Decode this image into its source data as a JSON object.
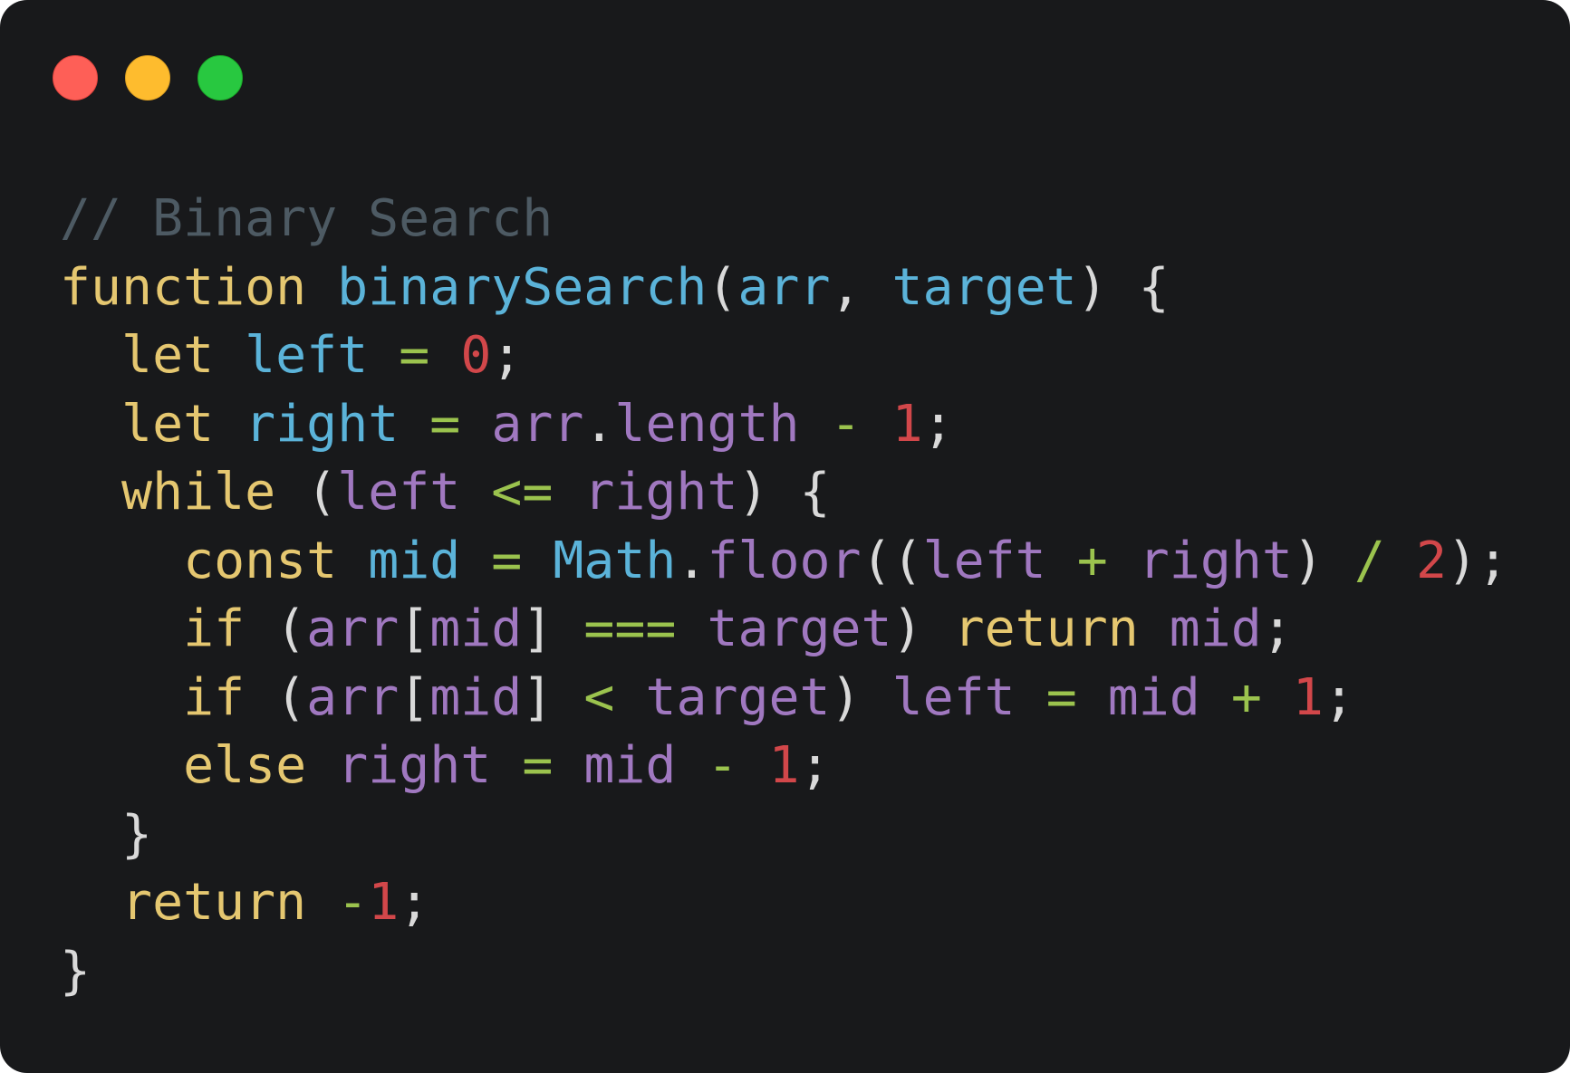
{
  "window": {
    "controls": [
      {
        "name": "close-button",
        "color": "#fe5f57"
      },
      {
        "name": "minimize-button",
        "color": "#febc2e"
      },
      {
        "name": "maximize-button",
        "color": "#28c840"
      }
    ]
  },
  "colors": {
    "background": "#18191b",
    "comment": "#4d5a63",
    "keyword": "#e5c770",
    "identifier": "#5bb3d9",
    "variable": "#a078c0",
    "operator": "#9bc34e",
    "number": "#d2474a",
    "punctuation": "#d9d9d9"
  },
  "code": {
    "language": "javascript",
    "lines": [
      [
        {
          "t": "// Binary Search",
          "k": "comment"
        }
      ],
      [
        {
          "t": "function",
          "k": "keyword"
        },
        {
          "t": " ",
          "k": "punctuation"
        },
        {
          "t": "binarySearch",
          "k": "identifier"
        },
        {
          "t": "(",
          "k": "punctuation"
        },
        {
          "t": "arr",
          "k": "identifier"
        },
        {
          "t": ", ",
          "k": "punctuation"
        },
        {
          "t": "target",
          "k": "identifier"
        },
        {
          "t": ") {",
          "k": "punctuation"
        }
      ],
      [
        {
          "t": "  ",
          "k": "punctuation"
        },
        {
          "t": "let",
          "k": "keyword"
        },
        {
          "t": " ",
          "k": "punctuation"
        },
        {
          "t": "left",
          "k": "identifier"
        },
        {
          "t": " ",
          "k": "punctuation"
        },
        {
          "t": "=",
          "k": "operator"
        },
        {
          "t": " ",
          "k": "punctuation"
        },
        {
          "t": "0",
          "k": "number"
        },
        {
          "t": ";",
          "k": "punctuation"
        }
      ],
      [
        {
          "t": "  ",
          "k": "punctuation"
        },
        {
          "t": "let",
          "k": "keyword"
        },
        {
          "t": " ",
          "k": "punctuation"
        },
        {
          "t": "right",
          "k": "identifier"
        },
        {
          "t": " ",
          "k": "punctuation"
        },
        {
          "t": "=",
          "k": "operator"
        },
        {
          "t": " ",
          "k": "punctuation"
        },
        {
          "t": "arr",
          "k": "variable"
        },
        {
          "t": ".",
          "k": "punctuation"
        },
        {
          "t": "length",
          "k": "variable"
        },
        {
          "t": " ",
          "k": "punctuation"
        },
        {
          "t": "-",
          "k": "operator"
        },
        {
          "t": " ",
          "k": "punctuation"
        },
        {
          "t": "1",
          "k": "number"
        },
        {
          "t": ";",
          "k": "punctuation"
        }
      ],
      [
        {
          "t": "  ",
          "k": "punctuation"
        },
        {
          "t": "while",
          "k": "keyword"
        },
        {
          "t": " (",
          "k": "punctuation"
        },
        {
          "t": "left",
          "k": "variable"
        },
        {
          "t": " ",
          "k": "punctuation"
        },
        {
          "t": "<=",
          "k": "operator"
        },
        {
          "t": " ",
          "k": "punctuation"
        },
        {
          "t": "right",
          "k": "variable"
        },
        {
          "t": ") {",
          "k": "punctuation"
        }
      ],
      [
        {
          "t": "    ",
          "k": "punctuation"
        },
        {
          "t": "const",
          "k": "keyword"
        },
        {
          "t": " ",
          "k": "punctuation"
        },
        {
          "t": "mid",
          "k": "identifier"
        },
        {
          "t": " ",
          "k": "punctuation"
        },
        {
          "t": "=",
          "k": "operator"
        },
        {
          "t": " ",
          "k": "punctuation"
        },
        {
          "t": "Math",
          "k": "identifier"
        },
        {
          "t": ".",
          "k": "punctuation"
        },
        {
          "t": "floor",
          "k": "variable"
        },
        {
          "t": "((",
          "k": "punctuation"
        },
        {
          "t": "left",
          "k": "variable"
        },
        {
          "t": " ",
          "k": "punctuation"
        },
        {
          "t": "+",
          "k": "operator"
        },
        {
          "t": " ",
          "k": "punctuation"
        },
        {
          "t": "right",
          "k": "variable"
        },
        {
          "t": ") ",
          "k": "punctuation"
        },
        {
          "t": "/",
          "k": "operator"
        },
        {
          "t": " ",
          "k": "punctuation"
        },
        {
          "t": "2",
          "k": "number"
        },
        {
          "t": ");",
          "k": "punctuation"
        }
      ],
      [
        {
          "t": "    ",
          "k": "punctuation"
        },
        {
          "t": "if",
          "k": "keyword"
        },
        {
          "t": " (",
          "k": "punctuation"
        },
        {
          "t": "arr",
          "k": "variable"
        },
        {
          "t": "[",
          "k": "punctuation"
        },
        {
          "t": "mid",
          "k": "variable"
        },
        {
          "t": "] ",
          "k": "punctuation"
        },
        {
          "t": "===",
          "k": "operator"
        },
        {
          "t": " ",
          "k": "punctuation"
        },
        {
          "t": "target",
          "k": "variable"
        },
        {
          "t": ") ",
          "k": "punctuation"
        },
        {
          "t": "return",
          "k": "keyword"
        },
        {
          "t": " ",
          "k": "punctuation"
        },
        {
          "t": "mid",
          "k": "variable"
        },
        {
          "t": ";",
          "k": "punctuation"
        }
      ],
      [
        {
          "t": "    ",
          "k": "punctuation"
        },
        {
          "t": "if",
          "k": "keyword"
        },
        {
          "t": " (",
          "k": "punctuation"
        },
        {
          "t": "arr",
          "k": "variable"
        },
        {
          "t": "[",
          "k": "punctuation"
        },
        {
          "t": "mid",
          "k": "variable"
        },
        {
          "t": "] ",
          "k": "punctuation"
        },
        {
          "t": "<",
          "k": "operator"
        },
        {
          "t": " ",
          "k": "punctuation"
        },
        {
          "t": "target",
          "k": "variable"
        },
        {
          "t": ") ",
          "k": "punctuation"
        },
        {
          "t": "left",
          "k": "variable"
        },
        {
          "t": " ",
          "k": "punctuation"
        },
        {
          "t": "=",
          "k": "operator"
        },
        {
          "t": " ",
          "k": "punctuation"
        },
        {
          "t": "mid",
          "k": "variable"
        },
        {
          "t": " ",
          "k": "punctuation"
        },
        {
          "t": "+",
          "k": "operator"
        },
        {
          "t": " ",
          "k": "punctuation"
        },
        {
          "t": "1",
          "k": "number"
        },
        {
          "t": ";",
          "k": "punctuation"
        }
      ],
      [
        {
          "t": "    ",
          "k": "punctuation"
        },
        {
          "t": "else",
          "k": "keyword"
        },
        {
          "t": " ",
          "k": "punctuation"
        },
        {
          "t": "right",
          "k": "variable"
        },
        {
          "t": " ",
          "k": "punctuation"
        },
        {
          "t": "=",
          "k": "operator"
        },
        {
          "t": " ",
          "k": "punctuation"
        },
        {
          "t": "mid",
          "k": "variable"
        },
        {
          "t": " ",
          "k": "punctuation"
        },
        {
          "t": "-",
          "k": "operator"
        },
        {
          "t": " ",
          "k": "punctuation"
        },
        {
          "t": "1",
          "k": "number"
        },
        {
          "t": ";",
          "k": "punctuation"
        }
      ],
      [
        {
          "t": "  }",
          "k": "punctuation"
        }
      ],
      [
        {
          "t": "  ",
          "k": "punctuation"
        },
        {
          "t": "return",
          "k": "keyword"
        },
        {
          "t": " ",
          "k": "punctuation"
        },
        {
          "t": "-",
          "k": "operator"
        },
        {
          "t": "1",
          "k": "number"
        },
        {
          "t": ";",
          "k": "punctuation"
        }
      ],
      [
        {
          "t": "}",
          "k": "punctuation"
        }
      ]
    ]
  }
}
